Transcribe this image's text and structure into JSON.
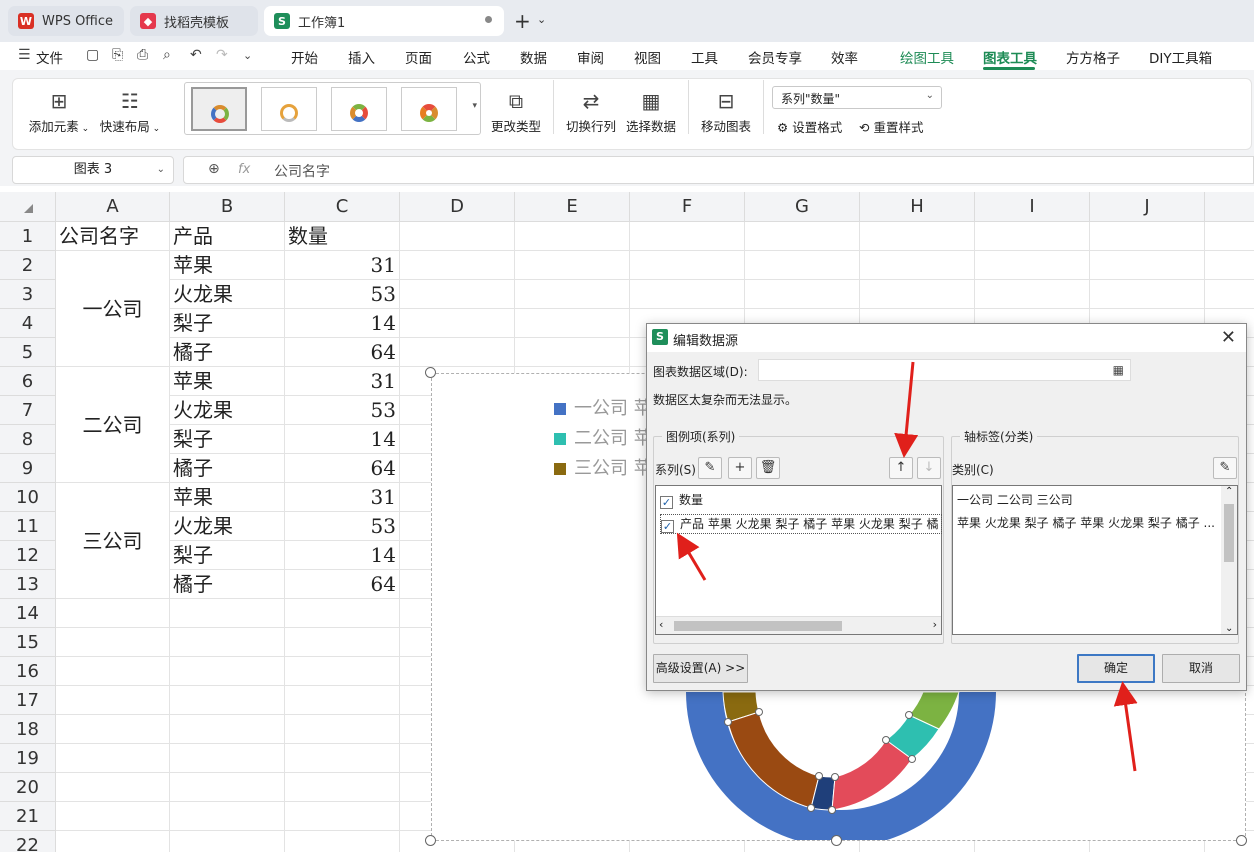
{
  "tabs": [
    {
      "label": "WPS Office",
      "icon": "wps-logo-icon",
      "color": "#d93025"
    },
    {
      "label": "找稻壳模板",
      "icon": "docer-logo-icon",
      "color": "#e5394d"
    },
    {
      "label": "工作簿1",
      "icon": "spreadsheet-s-icon",
      "color": "#1e8e5a"
    }
  ],
  "menubar": {
    "file": "文件",
    "items": [
      "开始",
      "插入",
      "页面",
      "公式",
      "数据",
      "审阅",
      "视图",
      "工具",
      "会员专享",
      "效率",
      "绘图工具",
      "图表工具",
      "方方格子",
      "DIY工具箱"
    ],
    "active": "图表工具"
  },
  "ribbon": {
    "add_element": "添加元素",
    "quick_layout": "快速布局",
    "change_type": "更改类型",
    "switch_rowcol": "切换行列",
    "select_data": "选择数据",
    "move_chart": "移动图表",
    "series_select": "系列\"数量\"",
    "set_format": "设置格式",
    "reset_style": "重置样式"
  },
  "formula_bar": {
    "name_box": "图表 3",
    "fx": "fx",
    "value": "公司名字"
  },
  "columns": [
    "A",
    "B",
    "C",
    "D",
    "E",
    "F",
    "G",
    "H",
    "I",
    "J"
  ],
  "rows": [
    "1",
    "2",
    "3",
    "4",
    "5",
    "6",
    "7",
    "8",
    "9",
    "10",
    "11",
    "12",
    "13",
    "14",
    "15",
    "16",
    "17",
    "18",
    "19",
    "20",
    "21",
    "22"
  ],
  "sheet": {
    "header": [
      "公司名字",
      "产品",
      "数量"
    ],
    "companies": [
      "一公司",
      "二公司",
      "三公司"
    ],
    "products": [
      "苹果",
      "火龙果",
      "梨子",
      "橘子",
      "苹果",
      "火龙果",
      "梨子",
      "橘子",
      "苹果",
      "火龙果",
      "梨子",
      "橘子"
    ],
    "quantities": [
      "31",
      "53",
      "14",
      "64",
      "31",
      "53",
      "14",
      "64",
      "31",
      "53",
      "14",
      "64"
    ]
  },
  "chart": {
    "legend": [
      {
        "label": "一公司 苹",
        "color": "#4472c4"
      },
      {
        "label": "二公司 苹",
        "color": "#2ebfb0"
      },
      {
        "label": "三公司 苹",
        "color": "#8a6a10"
      }
    ]
  },
  "dialog": {
    "title": "编辑数据源",
    "range_label": "图表数据区域(D):",
    "range_value": "",
    "message": "数据区太复杂而无法显示。",
    "legend_group": "图例项(系列)",
    "axis_group": "轴标签(分类)",
    "series_label": "系列(S)",
    "category_label": "类别(C)",
    "series_items": [
      {
        "label": "数量",
        "checked": true
      },
      {
        "label": "产品 苹果 火龙果 梨子 橘子 苹果 火龙果 梨子 橘",
        "checked": true
      }
    ],
    "category_items": [
      "一公司 二公司 三公司",
      "苹果 火龙果 梨子 橘子 苹果 火龙果 梨子 橘子 ..."
    ],
    "advanced": "高级设置(A) >>",
    "ok": "确定",
    "cancel": "取消"
  },
  "colors": {
    "accent_green": "#1d8b55",
    "arrow_red": "#e0201b",
    "ok_border": "#3d78c4"
  }
}
